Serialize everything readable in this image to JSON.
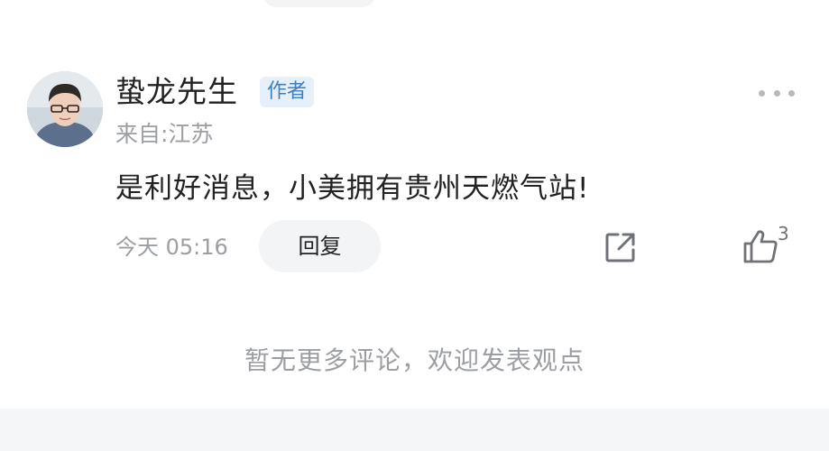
{
  "comment": {
    "user": {
      "name": "蛰龙先生",
      "badge": "作者",
      "location": "来自:江苏",
      "avatar_icon": "user-avatar-photo"
    },
    "text": "是利好消息，小美拥有贵州天燃气站!",
    "timestamp": "今天 05:16",
    "reply_label": "回复",
    "like_count": "3",
    "icons": {
      "more": "more-dots-icon",
      "share": "share-external-icon",
      "like": "thumbs-up-icon"
    }
  },
  "footer": {
    "message": "暂无更多评论，欢迎发表观点"
  },
  "colors": {
    "primary_text": "#222222",
    "secondary_text": "#9b9ea3",
    "badge_bg": "#e6f0fb",
    "badge_text": "#3d7fc2",
    "pill_bg": "#f3f4f6"
  }
}
